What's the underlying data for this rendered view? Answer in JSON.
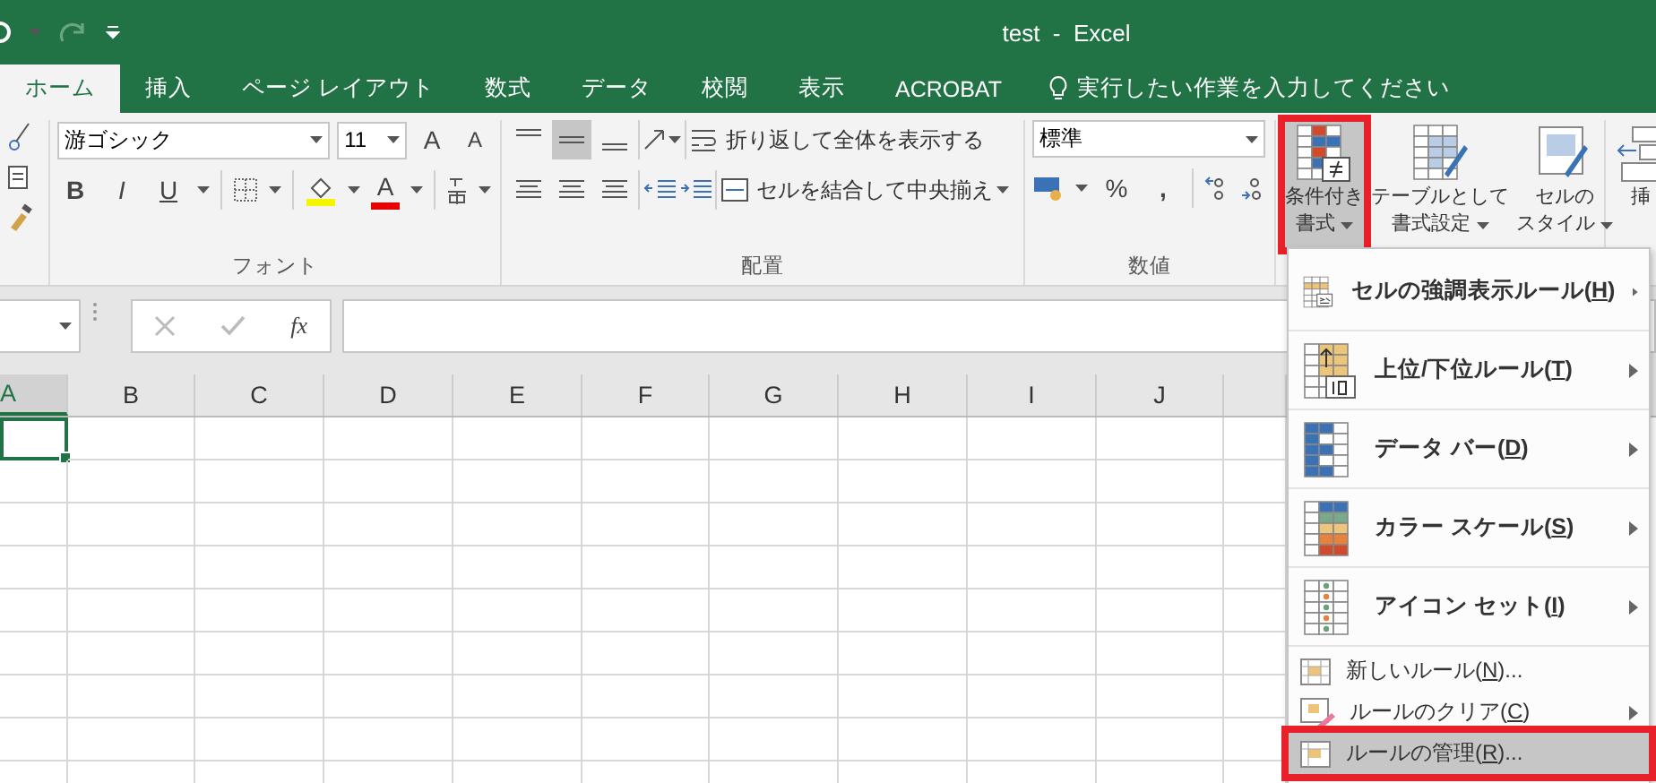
{
  "title_bar": {
    "title": "test  -  Excel"
  },
  "tabs": [
    {
      "label": "ホーム",
      "selected": true
    },
    {
      "label": "挿入",
      "selected": false
    },
    {
      "label": "ページ レイアウト",
      "selected": false
    },
    {
      "label": "数式",
      "selected": false
    },
    {
      "label": "データ",
      "selected": false
    },
    {
      "label": "校閲",
      "selected": false
    },
    {
      "label": "表示",
      "selected": false
    },
    {
      "label": "ACROBAT",
      "selected": false
    }
  ],
  "tell_me": {
    "placeholder": "実行したい作業を入力してください"
  },
  "ribbon": {
    "font": {
      "name": "游ゴシック",
      "size": "11",
      "grow": "A",
      "shrink": "A",
      "bold": "B",
      "italic": "I",
      "underline": "U",
      "font_color": "A",
      "label": "フォント"
    },
    "alignment": {
      "vertical": [
        {
          "selected": false
        },
        {
          "selected": true
        },
        {
          "selected": false
        }
      ],
      "wrap": "折り返して全体を表示する",
      "merge": "セルを結合して中央揃え",
      "label": "配置"
    },
    "number": {
      "format": "標準",
      "percent": "%",
      "comma": ",",
      "label": "数値"
    },
    "styles": [
      {
        "lines": [
          "条件付き",
          "書式"
        ],
        "pressed": true,
        "annotated": true
      },
      {
        "lines": [
          "テーブルとして",
          "書式設定"
        ],
        "pressed": false,
        "annotated": false
      },
      {
        "lines": [
          "セルの",
          "スタイル"
        ],
        "pressed": false,
        "annotated": false
      }
    ],
    "cells": [
      {
        "lines": [
          "挿"
        ]
      }
    ]
  },
  "formula_bar": {
    "function_label": "fx"
  },
  "columns": [
    {
      "label": "A",
      "selected": true
    },
    {
      "label": "B",
      "selected": false
    },
    {
      "label": "C",
      "selected": false
    },
    {
      "label": "D",
      "selected": false
    },
    {
      "label": "E",
      "selected": false
    },
    {
      "label": "F",
      "selected": false
    },
    {
      "label": "G",
      "selected": false
    },
    {
      "label": "H",
      "selected": false
    },
    {
      "label": "I",
      "selected": false
    },
    {
      "label": "J",
      "selected": false
    }
  ],
  "menu": {
    "items": [
      {
        "kind": "large",
        "before": "セルの強調表示ルール(",
        "accelerator": "H",
        "after": ")",
        "submenu": true,
        "selected": false,
        "annotated": false
      },
      {
        "kind": "large",
        "before": "上位/下位ルール(",
        "accelerator": "T",
        "after": ")",
        "submenu": true,
        "selected": false,
        "annotated": false
      },
      {
        "kind": "large",
        "before": "データ バー(",
        "accelerator": "D",
        "after": ")",
        "submenu": true,
        "selected": false,
        "annotated": false
      },
      {
        "kind": "large",
        "before": "カラー スケール(",
        "accelerator": "S",
        "after": ")",
        "submenu": true,
        "selected": false,
        "annotated": false
      },
      {
        "kind": "large",
        "before": "アイコン セット(",
        "accelerator": "I",
        "after": ")",
        "submenu": true,
        "selected": false,
        "annotated": false
      },
      {
        "kind": "small",
        "before": "新しいルール(",
        "accelerator": "N",
        "after": ")...",
        "submenu": false,
        "selected": false,
        "annotated": false
      },
      {
        "kind": "small",
        "before": "ルールのクリア(",
        "accelerator": "C",
        "after": ")",
        "submenu": true,
        "selected": false,
        "annotated": false
      },
      {
        "kind": "small",
        "before": "ルールの管理(",
        "accelerator": "R",
        "after": ")...",
        "submenu": false,
        "selected": true,
        "annotated": true
      }
    ]
  }
}
